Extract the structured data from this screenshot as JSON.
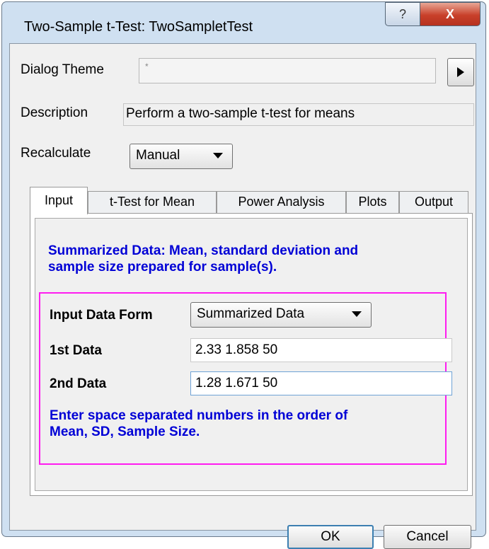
{
  "window": {
    "title": "Two-Sample t-Test: TwoSampletTest",
    "help_glyph": "?",
    "close_glyph": "X"
  },
  "dialog_theme": {
    "label": "Dialog Theme",
    "value": "*"
  },
  "description": {
    "label": "Description",
    "value": "Perform a two-sample t-test for means"
  },
  "recalculate": {
    "label": "Recalculate",
    "value": "Manual"
  },
  "tabs": [
    {
      "label": "Input",
      "active": true
    },
    {
      "label": "t-Test for Mean"
    },
    {
      "label": "Power Analysis"
    },
    {
      "label": "Plots"
    },
    {
      "label": "Output"
    }
  ],
  "input_tab": {
    "info_line1": "Summarized Data: Mean, standard deviation and",
    "info_line2": "sample size prepared for sample(s).",
    "input_form": {
      "label": "Input Data Form",
      "value": "Summarized Data"
    },
    "first_data": {
      "label": "1st Data",
      "value": "2.33 1.858 50"
    },
    "second_data": {
      "label": "2nd Data",
      "value": "1.28 1.671 50"
    },
    "hint_line1": "Enter space separated numbers in the order of",
    "hint_line2": "Mean, SD, Sample Size."
  },
  "buttons": {
    "ok": "OK",
    "cancel": "Cancel"
  },
  "colors": {
    "info_text": "#0000d6",
    "group_border": "#ff1cf0",
    "close_button": "#c8402a"
  },
  "icons": {
    "run_arrow": "play-triangle-icon",
    "dropdown": "chevron-down-icon"
  }
}
